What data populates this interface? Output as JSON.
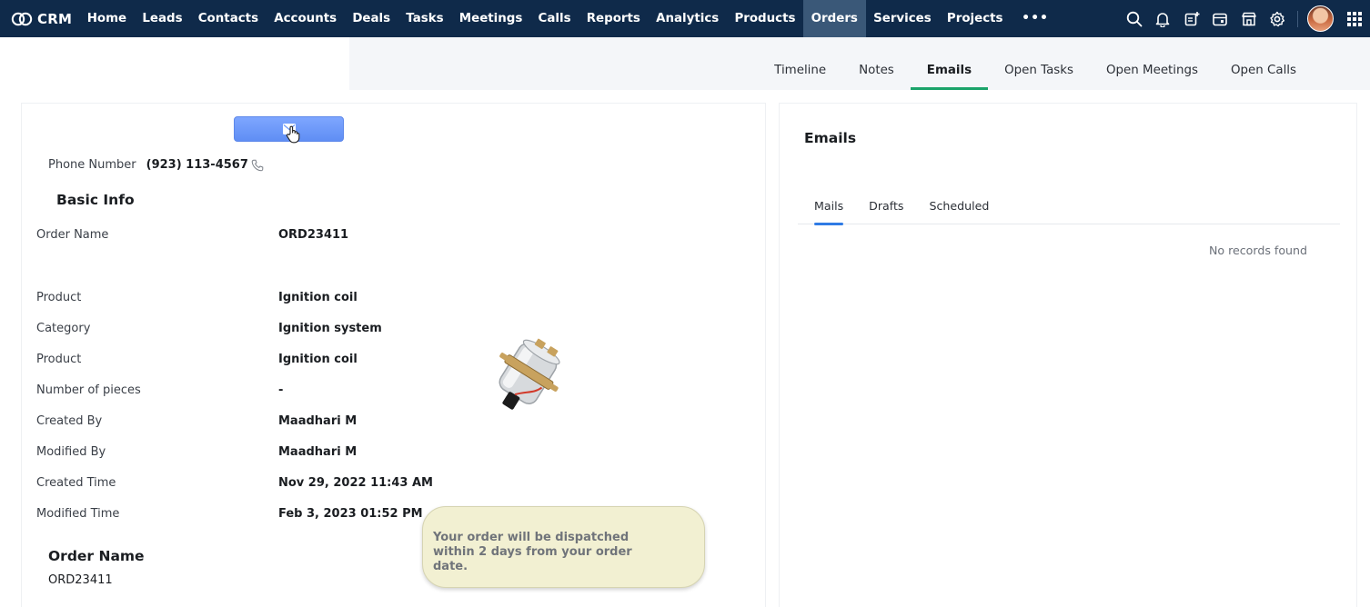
{
  "brand": {
    "name": "CRM"
  },
  "nav": {
    "items": [
      {
        "label": "Home",
        "active": false
      },
      {
        "label": "Leads",
        "active": false
      },
      {
        "label": "Contacts",
        "active": false
      },
      {
        "label": "Accounts",
        "active": false
      },
      {
        "label": "Deals",
        "active": false
      },
      {
        "label": "Tasks",
        "active": false
      },
      {
        "label": "Meetings",
        "active": false
      },
      {
        "label": "Calls",
        "active": false
      },
      {
        "label": "Reports",
        "active": false
      },
      {
        "label": "Analytics",
        "active": false
      },
      {
        "label": "Products",
        "active": false
      },
      {
        "label": "Orders",
        "active": true
      },
      {
        "label": "Services",
        "active": false
      },
      {
        "label": "Projects",
        "active": false
      }
    ],
    "more_label": "•••",
    "icons": [
      "search-icon",
      "bell-icon",
      "create-note-icon",
      "calendar-icon",
      "store-icon",
      "gear-icon",
      "avatar",
      "apps-grid-icon"
    ]
  },
  "related_tabs": [
    {
      "label": "Timeline",
      "active": false
    },
    {
      "label": "Notes",
      "active": false
    },
    {
      "label": "Emails",
      "active": true
    },
    {
      "label": "Open Tasks",
      "active": false
    },
    {
      "label": "Open Meetings",
      "active": false
    },
    {
      "label": "Open Calls",
      "active": false
    }
  ],
  "details": {
    "email_button_icon": "envelope-icon",
    "phone": {
      "label": "Phone Number",
      "value": "(923) 113-4567"
    },
    "basic_info_title": "Basic Info",
    "fields": [
      {
        "label": "Order Name",
        "value": "ORD23411"
      },
      {
        "label": "Product",
        "value": "Ignition coil"
      },
      {
        "label": "Category",
        "value": "Ignition system"
      },
      {
        "label": "Product",
        "value": "Ignition coil"
      },
      {
        "label": "Number of pieces",
        "value": "-"
      },
      {
        "label": "Created By",
        "value": "Maadhari M"
      },
      {
        "label": "Modified By",
        "value": "Maadhari M"
      },
      {
        "label": "Created Time",
        "value": "Nov 29, 2022 11:43 AM"
      },
      {
        "label": "Modified Time",
        "value": "Feb 3, 2023 01:52 PM"
      }
    ],
    "order_name_section": {
      "title": "Order Name",
      "value": "ORD23411"
    },
    "tooltip": "Your order will be dispatched within 2 days from your order date."
  },
  "emails_panel": {
    "title": "Emails",
    "tabs": [
      {
        "label": "Mails",
        "active": true
      },
      {
        "label": "Drafts",
        "active": false
      },
      {
        "label": "Scheduled",
        "active": false
      }
    ],
    "empty_text": "No records found"
  },
  "colors": {
    "nav_bg": "#0f2a4a",
    "nav_active": "#3a5878",
    "tab_underline": "#1aa36a",
    "mail_tab_underline": "#2f7be5",
    "email_button": "#6b97f7",
    "tooltip_bg": "#f2f0d2"
  }
}
